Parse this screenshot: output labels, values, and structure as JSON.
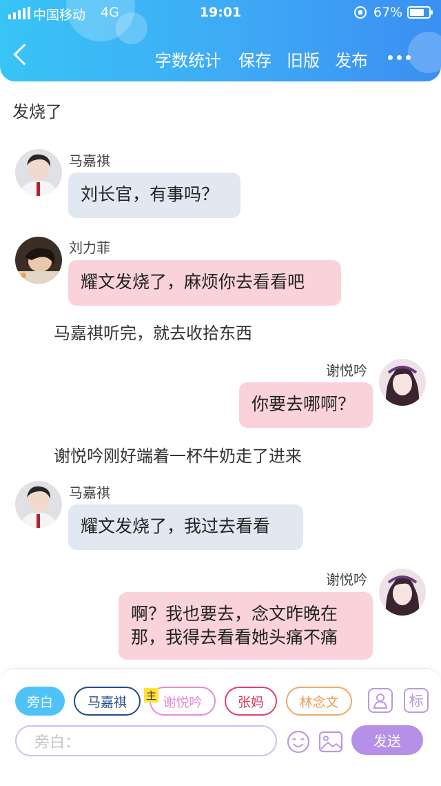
{
  "status_bar": {
    "carrier": "中国移动",
    "network": "4G",
    "time": "19:01",
    "battery": "67%"
  },
  "toolbar": {
    "word_count": "字数统计",
    "save": "保存",
    "old_version": "旧版",
    "publish": "发布"
  },
  "chat": {
    "title_line": "发烧了",
    "messages": [
      {
        "speaker": "马嘉祺",
        "text": "刘长官，有事吗？"
      },
      {
        "speaker": "刘力菲",
        "text": "耀文发烧了，麻烦你去看看吧"
      },
      {
        "narration": "马嘉祺听完，就去收拾东西"
      },
      {
        "speaker": "谢悦吟",
        "text": "你要去哪啊？"
      },
      {
        "narration": "谢悦吟刚好端着一杯牛奶走了进来"
      },
      {
        "speaker": "马嘉祺",
        "text": "耀文发烧了，我过去看看"
      },
      {
        "speaker": "谢悦吟",
        "text_line1": "啊？我也要去，念文昨晚在",
        "text_line2": "那，我得去看看她头痛不痛"
      }
    ]
  },
  "composer": {
    "roles": [
      "旁白",
      "马嘉祺",
      "谢悦吟",
      "张妈",
      "林念文"
    ],
    "main_tag": "主",
    "tag_button": "标",
    "input_placeholder": "旁白：",
    "send": "发送"
  },
  "colors": {
    "header_start": "#38c4f5",
    "header_end": "#3a8ff2",
    "bubble_blue": "#e2e8f2",
    "bubble_pink": "#f9d2da",
    "send_button": "#b690e6"
  }
}
